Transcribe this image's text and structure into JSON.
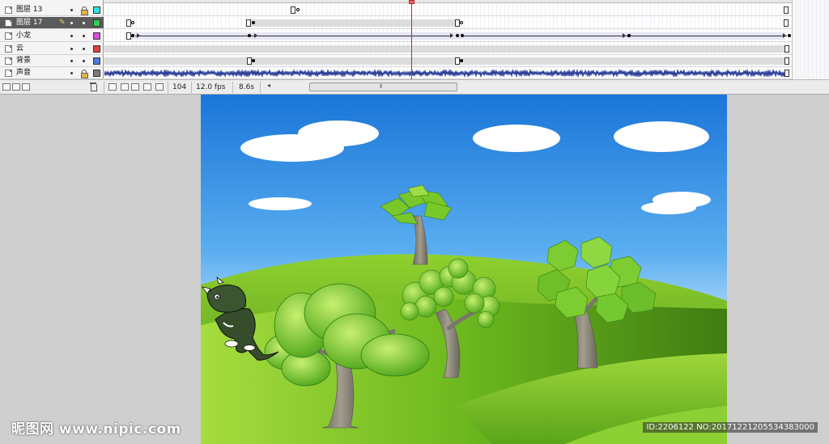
{
  "timeline": {
    "layers": [
      {
        "name": "图层 13",
        "color": "#33e1e1",
        "selected": false,
        "locked": true
      },
      {
        "name": "图层 17",
        "color": "#2fd24f",
        "selected": true,
        "locked": false
      },
      {
        "name": "小龙",
        "color": "#d84fd8",
        "selected": false,
        "locked": false
      },
      {
        "name": "云",
        "color": "#e24040",
        "selected": false,
        "locked": false
      },
      {
        "name": "背景",
        "color": "#4f78e0",
        "selected": false,
        "locked": false
      },
      {
        "name": "声音",
        "color": "#7b7b7b",
        "selected": false,
        "locked": true
      }
    ],
    "status": {
      "frame": "104",
      "fps": "12.0 fps",
      "time": "8.6s"
    }
  },
  "stage": {
    "sky_top": "#1a75d8",
    "sky_bottom": "#dcefff",
    "hill_color": "#6cb81e"
  },
  "watermark": {
    "site": "昵图网 www.nipic.com",
    "id": "ID:2206122 NO:20171221205534383000"
  }
}
